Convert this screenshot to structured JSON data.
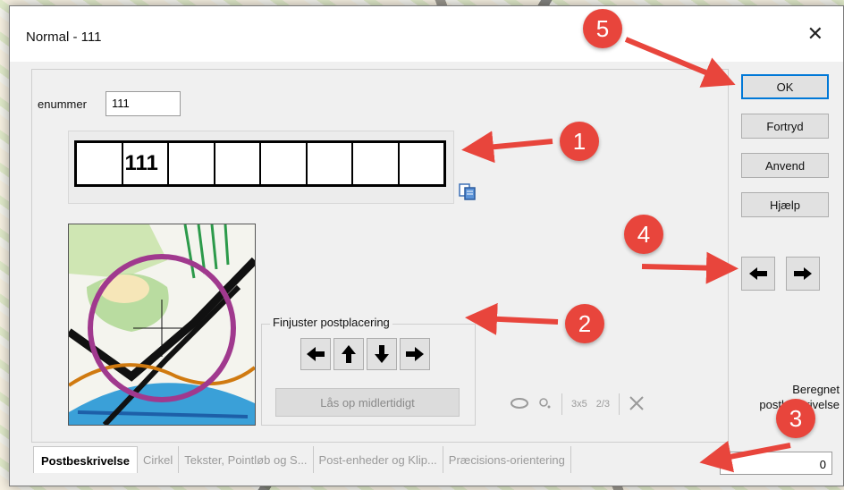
{
  "window": {
    "title": "Normal - 111",
    "close_glyph": "✕"
  },
  "number": {
    "label": "enummer",
    "value": "111"
  },
  "code_box": {
    "cells": [
      "",
      "111",
      "",
      "",
      "",
      "",
      "",
      ""
    ]
  },
  "finjuster": {
    "legend": "Finjuster postplacering",
    "lock_button": "Lås op midlertidigt",
    "tool_labels": {
      "grid": "3x5",
      "fraction": "2/3"
    }
  },
  "right_buttons": {
    "ok": "OK",
    "cancel": "Fortryd",
    "apply": "Anvend",
    "help": "Hjælp"
  },
  "calculated": {
    "label_line1": "Beregnet",
    "label_line2": "postbeskrivelse",
    "value": "0"
  },
  "tabs": [
    {
      "label": "Postbeskrivelse",
      "active": true
    },
    {
      "label": "Cirkel",
      "active": false
    },
    {
      "label": "Tekster, Pointløb og S...",
      "active": false
    },
    {
      "label": "Post-enheder og Klip...",
      "active": false
    },
    {
      "label": "Præcisions-orientering",
      "active": false
    }
  ],
  "callouts": [
    "1",
    "2",
    "3",
    "4",
    "5"
  ],
  "colors": {
    "callout": "#e8453c",
    "accent_focus": "#0078d7",
    "control_circle": "#a0398e"
  }
}
